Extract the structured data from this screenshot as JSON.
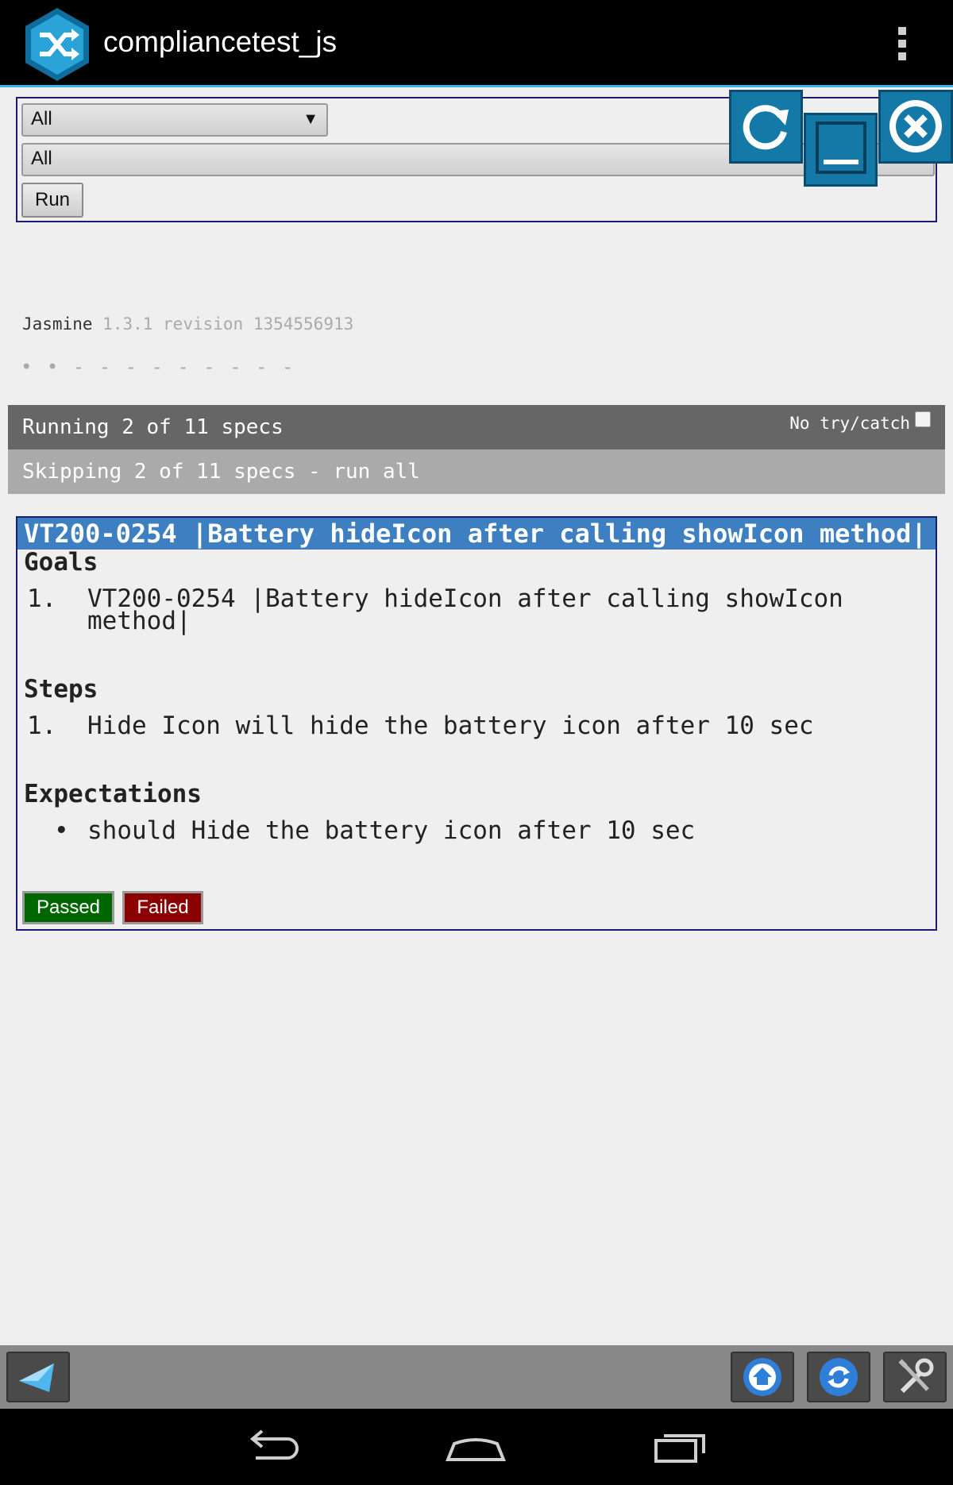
{
  "app": {
    "title": "compliancetest_js"
  },
  "selectors": {
    "filter_primary": "All",
    "filter_secondary": "All",
    "run_label": "Run"
  },
  "jasmine": {
    "name": "Jasmine",
    "version": "1.3.1 revision 1354556913",
    "progress_dots": "• • - - - - - - - - -"
  },
  "summary": {
    "running": "Running 2 of 11 specs",
    "no_try_catch_label": "No try/catch",
    "skipping": "Skipping 2 of 11 specs - run all"
  },
  "test": {
    "title": "VT200-0254 |Battery hideIcon after calling showIcon method|",
    "goals_heading": "Goals",
    "goals": [
      {
        "number": "1.",
        "line1": "VT200-0254 |Battery hideIcon after calling showIcon",
        "line2": "method|"
      }
    ],
    "steps_heading": "Steps",
    "steps": [
      {
        "number": "1.",
        "text": "Hide Icon will hide the battery icon after 10 sec"
      }
    ],
    "expectations_heading": "Expectations",
    "expectations": [
      {
        "bullet": "•",
        "text": "should Hide the battery icon after 10 sec"
      }
    ],
    "passed_label": "Passed",
    "failed_label": "Failed"
  },
  "icons": {
    "logo": "app-logo-icon",
    "reload": "reload-icon",
    "minimize": "minimize-icon",
    "close": "close-icon",
    "back": "back-arrow-icon",
    "home": "home-icon",
    "refresh": "refresh-icon",
    "settings": "wrench-icon"
  },
  "colors": {
    "accent": "#33b5e5",
    "title_bar": "#3d7fc1",
    "passed": "#006600",
    "failed": "#8b0000",
    "floating_button": "#1579a8"
  }
}
